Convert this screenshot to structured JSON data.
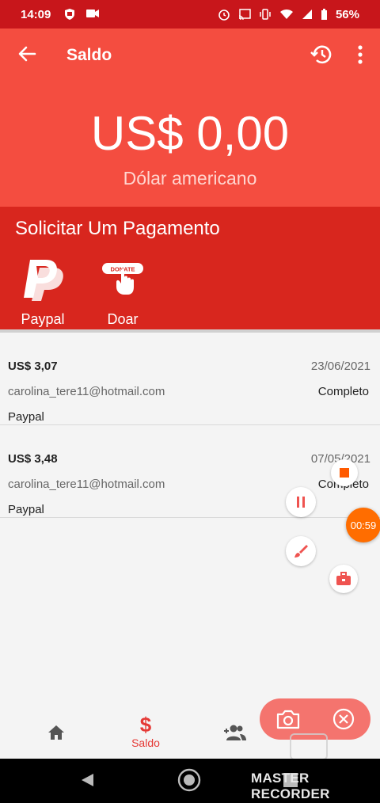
{
  "statusbar": {
    "time": "14:09",
    "battery": "56%"
  },
  "appbar": {
    "title": "Saldo"
  },
  "balance": {
    "amount": "US$ 0,00",
    "currency": "Dólar americano"
  },
  "request": {
    "title": "Solicitar Um Pagamento",
    "methods": [
      {
        "label": "Paypal"
      },
      {
        "label": "Doar",
        "badge_text": "DONATE"
      }
    ]
  },
  "transactions": [
    {
      "amount": "US$ 3,07",
      "date": "23/06/2021",
      "email": "carolina_tere11@hotmail.com",
      "status": "Completo",
      "method": "Paypal"
    },
    {
      "amount": "US$ 3,48",
      "date": "07/05/2021",
      "email": "carolina_tere11@hotmail.com",
      "status": "Completo",
      "method": "Paypal"
    }
  ],
  "bottomnav": {
    "active_label": "Saldo",
    "active_icon": "$"
  },
  "recorder": {
    "timer": "00:59",
    "watermark": "MASTER RECORDER"
  },
  "colors": {
    "primary": "#f44d40",
    "primary_dark": "#d8261e",
    "statusbar": "#c8161b",
    "accent": "#e53935",
    "timer": "#ff6d00"
  }
}
